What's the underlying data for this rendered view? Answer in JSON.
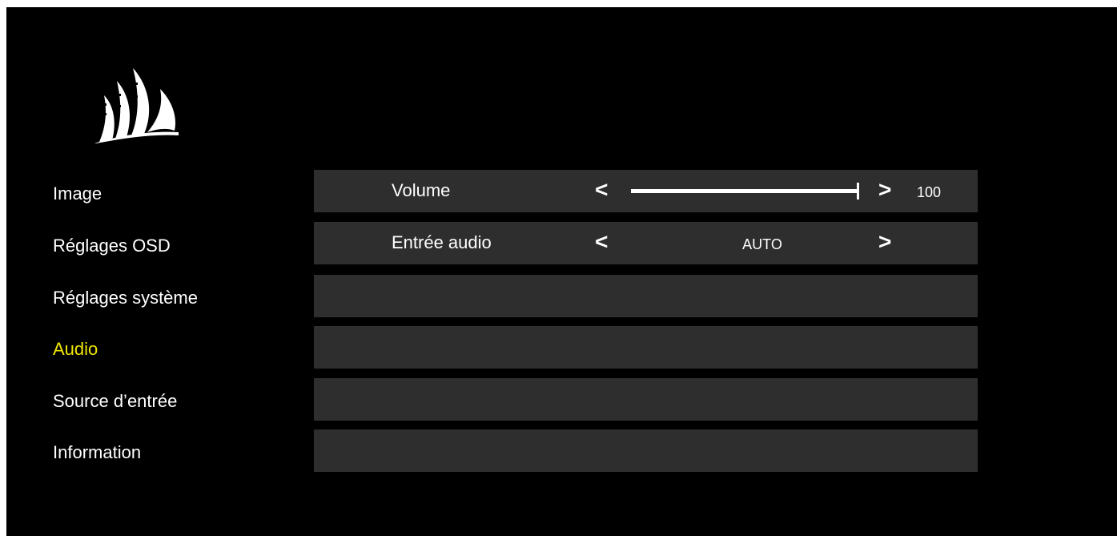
{
  "sidebar": {
    "items": [
      {
        "label": "Image"
      },
      {
        "label": "Réglages OSD"
      },
      {
        "label": "Réglages système"
      },
      {
        "label": "Audio",
        "active": true
      },
      {
        "label": "Source d’entrée"
      },
      {
        "label": "Information"
      }
    ]
  },
  "settings": {
    "volume": {
      "label": "Volume",
      "left_arrow": "<",
      "right_arrow": ">",
      "value": "100",
      "level_percent": 100
    },
    "audio_input": {
      "label": "Entrée audio",
      "left_arrow": "<",
      "right_arrow": ">",
      "value": "AUTO"
    }
  },
  "colors": {
    "background": "#000000",
    "row_background": "#2e2e2e",
    "text": "#ffffff",
    "active_text": "#f0e600"
  },
  "icons": {
    "logo": "corsair-sails-logo"
  }
}
